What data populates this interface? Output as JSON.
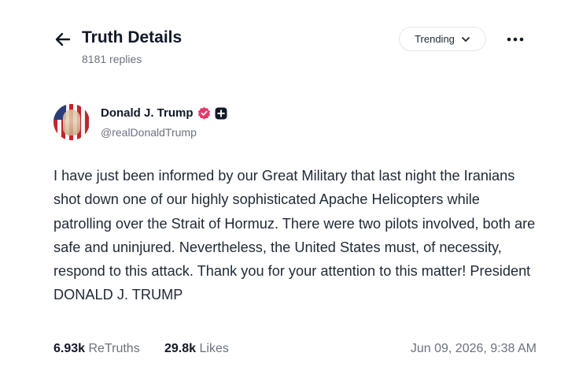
{
  "header": {
    "title": "Truth Details",
    "replies": "8181 replies",
    "sort_label": "Trending"
  },
  "post": {
    "author": {
      "name": "Donald J. Trump",
      "handle": "@realDonaldTrump"
    },
    "text": "I have just been informed by our Great Military that last night the Iranians shot down one of our highly sophisticated Apache Helicopters while patrolling over the Strait of Hormuz. There were two pilots involved, both are safe and uninjured. Nevertheless, the United States must, of necessity, respond to this attack. Thank you for your attention to this matter! President DONALD J. TRUMP",
    "retruths_count": "6.93k",
    "retruths_label": "ReTruths",
    "likes_count": "29.8k",
    "likes_label": "Likes",
    "timestamp": "Jun 09, 2026, 9:38 AM"
  },
  "icons": {
    "back": "arrow-left-icon",
    "dropdown": "chevron-down-icon",
    "more": "more-horizontal-icon",
    "verified": "verified-badge-icon",
    "secondary_badge": "plus-badge-icon"
  },
  "colors": {
    "verified": "#e5386b",
    "text": "#1f2937",
    "muted": "#6b7280"
  }
}
